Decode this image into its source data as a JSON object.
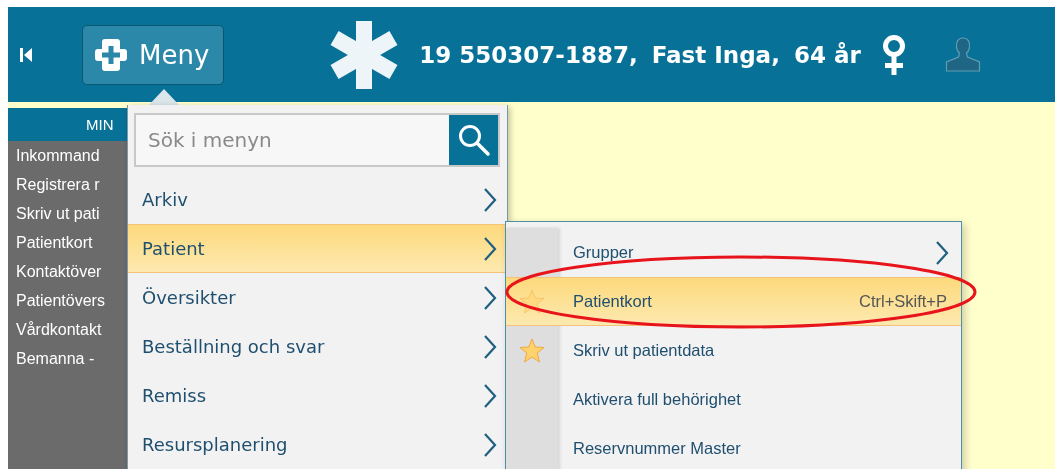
{
  "header": {
    "menu_button": "Meny",
    "patient_id": "19 550307-1887,",
    "patient_name": "Fast Inga,",
    "patient_age": "64 år"
  },
  "sidebar": {
    "title": "MIN",
    "items": [
      "Inkommand",
      "Registrera r",
      "Skriv ut pati",
      "Patientkort",
      "Kontaktöver",
      "Patientövers",
      "Vårdkontakt",
      "Bemanna -"
    ]
  },
  "menu": {
    "search": {
      "placeholder": "Sök i menyn"
    },
    "items": [
      {
        "label": "Arkiv",
        "selected": false
      },
      {
        "label": "Patient",
        "selected": true
      },
      {
        "label": "Översikter",
        "selected": false
      },
      {
        "label": "Beställning och svar",
        "selected": false
      },
      {
        "label": "Remiss",
        "selected": false
      },
      {
        "label": "Resursplanering",
        "selected": false
      }
    ]
  },
  "submenu": {
    "items": [
      {
        "label": "Grupper",
        "kind": "submenu",
        "selected": false,
        "starred": false
      },
      {
        "label": "Patientkort",
        "kind": "command",
        "shortcut": "Ctrl+Skift+P",
        "selected": true,
        "starred": true
      },
      {
        "label": "Skriv ut patientdata",
        "kind": "command",
        "selected": false,
        "starred": true
      },
      {
        "label": "Aktivera full behörighet",
        "kind": "command",
        "selected": false,
        "starred": false
      },
      {
        "label": "Reservnummer Master",
        "kind": "command",
        "selected": false,
        "starred": false
      }
    ]
  }
}
